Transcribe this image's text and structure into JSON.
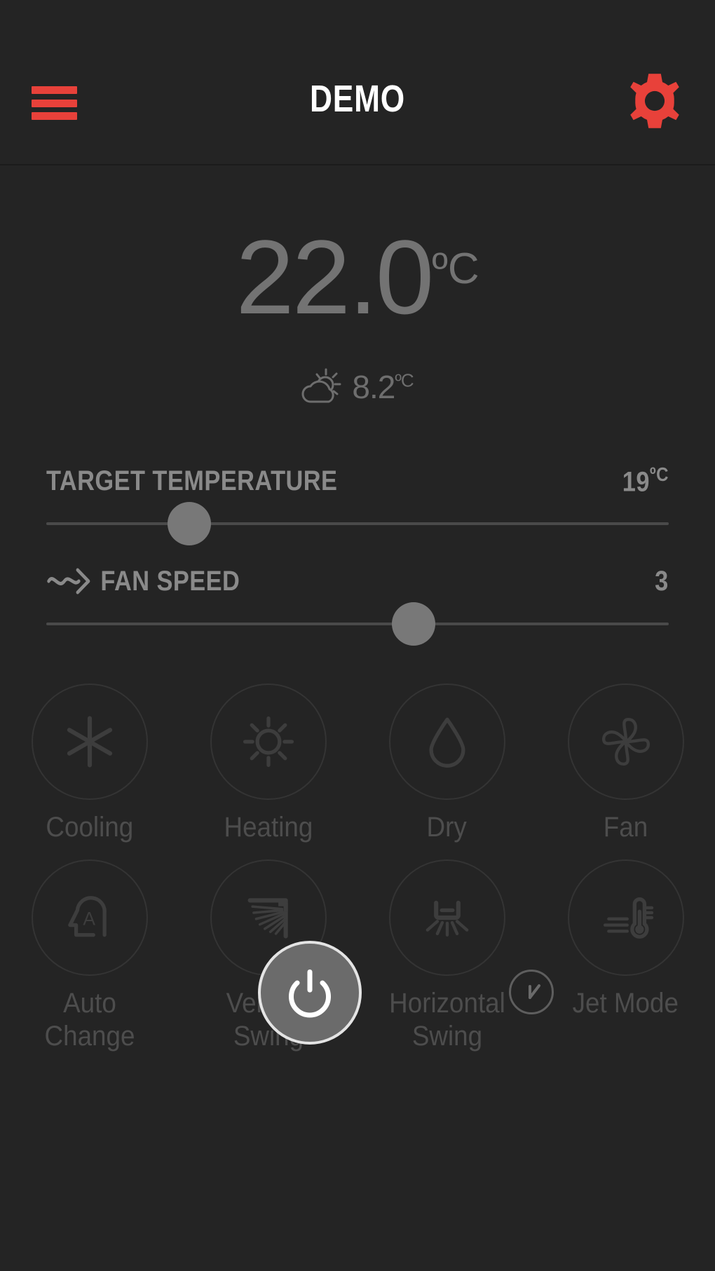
{
  "header": {
    "title": "DEMO",
    "menu_icon": "hamburger-menu-icon",
    "settings_icon": "gear-icon",
    "accent_color": "#e8413a"
  },
  "status": {
    "current_temperature": "22.0",
    "current_temperature_unit": "ºC",
    "outdoor_icon": "partly-cloudy-icon",
    "outdoor_temperature": "8.2",
    "outdoor_temperature_unit": "ºC"
  },
  "sliders": [
    {
      "name": "target-temperature",
      "label": "TARGET TEMPERATURE",
      "value": "19",
      "unit": "ºC",
      "icon": null,
      "percent": 23
    },
    {
      "name": "fan-speed",
      "label": "FAN SPEED",
      "value": "3",
      "unit": "",
      "icon": "airflow-arrow-icon",
      "percent": 59
    }
  ],
  "modes": [
    {
      "label": "Cooling",
      "icon": "snowflake-icon"
    },
    {
      "label": "Heating",
      "icon": "sun-icon"
    },
    {
      "label": "Dry",
      "icon": "water-drop-icon"
    },
    {
      "label": "Fan",
      "icon": "fan-blades-icon"
    },
    {
      "label": "Auto Change",
      "icon": "auto-head-icon"
    },
    {
      "label": "Vertical Swing",
      "icon": "vertical-swing-icon"
    },
    {
      "label": "Horizontal Swing",
      "icon": "horizontal-swing-icon"
    },
    {
      "label": "Jet Mode",
      "icon": "jet-thermometer-icon"
    }
  ],
  "footer": {
    "power_icon": "power-icon",
    "timer_icon": "timer-clock-icon"
  },
  "colors": {
    "background": "#242424",
    "accent": "#e8413a",
    "text_dim": "#7d7d7d",
    "text_muted": "#4d4d4d",
    "thumb": "#787878"
  }
}
